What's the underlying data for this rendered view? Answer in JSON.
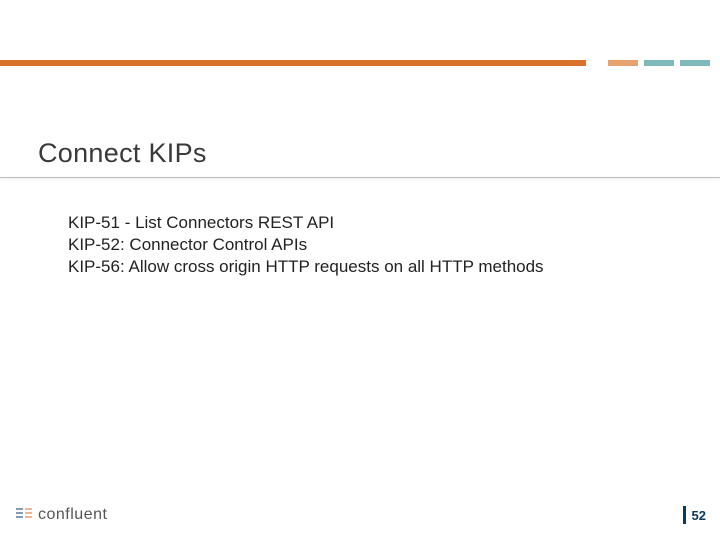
{
  "title": "Connect KIPs",
  "body": {
    "lines": [
      "KIP-51 - List Connectors REST API",
      "KIP-52: Connector Control APIs",
      "KIP-56: Allow cross origin HTTP requests on all HTTP methods"
    ]
  },
  "footer": {
    "brand": "confluent",
    "page": "52"
  },
  "colors": {
    "accent": "#d8722a",
    "accent_light": "#e7a36e",
    "teal": "#7fb9bb",
    "navy": "#0a3a5e"
  }
}
